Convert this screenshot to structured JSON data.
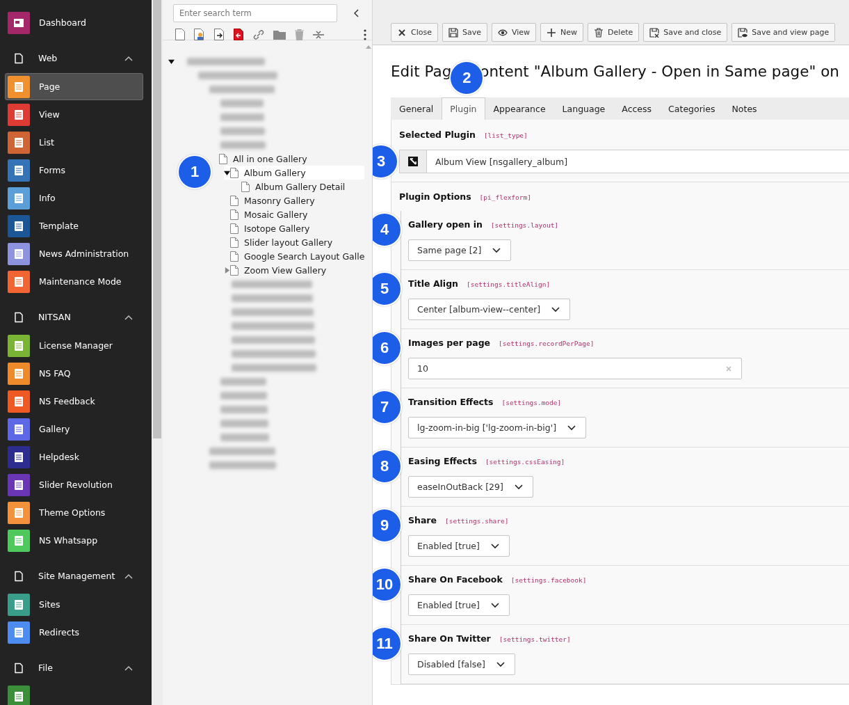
{
  "sidebar": {
    "sections": [
      {
        "kind": "link",
        "label": "Dashboard",
        "color": "#a4276a"
      },
      {
        "kind": "group",
        "label": "Web",
        "expanded": true,
        "items": [
          {
            "label": "Page",
            "color": "#f0902e",
            "selected": true
          },
          {
            "label": "View",
            "color": "#dd3b33",
            "selected": false
          },
          {
            "label": "List",
            "color": "#cf6434",
            "selected": false
          },
          {
            "label": "Forms",
            "color": "#3473b5",
            "selected": false
          },
          {
            "label": "Info",
            "color": "#5b9fd9",
            "selected": false
          },
          {
            "label": "Template",
            "color": "#1b5796",
            "selected": false
          },
          {
            "label": "News Administration",
            "color": "#8e93e0",
            "selected": false
          },
          {
            "label": "Maintenance Mode",
            "color": "#f16434",
            "selected": false
          }
        ]
      },
      {
        "kind": "group",
        "label": "NITSAN",
        "expanded": true,
        "items": [
          {
            "label": "License Manager",
            "color": "#7ab434",
            "selected": false
          },
          {
            "label": "NS FAQ",
            "color": "#ef8a2a",
            "selected": false
          },
          {
            "label": "NS Feedback",
            "color": "#ef5a24",
            "selected": false
          },
          {
            "label": "Gallery",
            "color": "#5d68e6",
            "selected": false
          },
          {
            "label": "Helpdesk",
            "color": "#2d2c8f",
            "selected": false
          },
          {
            "label": "Slider Revolution",
            "color": "#6a36b5",
            "selected": false
          },
          {
            "label": "Theme Options",
            "color": "#f4913b",
            "selected": false
          },
          {
            "label": "NS Whatsapp",
            "color": "#4fc95c",
            "selected": false
          }
        ]
      },
      {
        "kind": "group",
        "label": "Site Management",
        "expanded": true,
        "items": [
          {
            "label": "Sites",
            "color": "#3a9d8a",
            "selected": false
          },
          {
            "label": "Redirects",
            "color": "#4d8cf0",
            "selected": false
          }
        ]
      },
      {
        "kind": "group",
        "label": "File",
        "expanded": true,
        "items": [
          {
            "color": "#3c8f3a",
            "selected": false
          }
        ]
      }
    ]
  },
  "page_tree": {
    "search": {
      "placeholder": "Enter search term"
    },
    "nodes": [
      {
        "kind": "blurred",
        "expanded": true,
        "children": [
          {
            "kind": "blurred",
            "children": [
              {
                "kind": "blurred",
                "children": [
                  {
                    "kind": "blurred"
                  },
                  {
                    "kind": "blurred"
                  },
                  {
                    "kind": "blurred"
                  },
                  {
                    "kind": "blurred",
                    "children": [
                      {
                        "kind": "page",
                        "label": "All in one Gallery",
                        "selected": false,
                        "children": [
                          {
                            "kind": "page",
                            "label": "Album Gallery",
                            "selected": true,
                            "expanded": true,
                            "badge": "1",
                            "children": [
                              {
                                "kind": "page",
                                "label": "Album Gallery Detail",
                                "selected": false
                              }
                            ]
                          },
                          {
                            "kind": "page",
                            "label": "Masonry Gallery",
                            "selected": false
                          },
                          {
                            "kind": "page",
                            "label": "Mosaic Gallery",
                            "selected": false
                          },
                          {
                            "kind": "page",
                            "label": "Isotope Gallery",
                            "selected": false
                          },
                          {
                            "kind": "page",
                            "label": "Slider layout Gallery",
                            "selected": false
                          },
                          {
                            "kind": "page",
                            "label": "Google Search Layout Galle",
                            "selected": false
                          },
                          {
                            "kind": "page",
                            "label": "Zoom View Gallery",
                            "selected": false,
                            "expanded": false
                          }
                        ]
                      },
                      {
                        "kind": "blurred"
                      },
                      {
                        "kind": "blurred"
                      },
                      {
                        "kind": "blurred"
                      },
                      {
                        "kind": "blurred"
                      },
                      {
                        "kind": "blurred"
                      },
                      {
                        "kind": "blurred"
                      },
                      {
                        "kind": "blurred"
                      }
                    ]
                  },
                  {
                    "kind": "blurred"
                  },
                  {
                    "kind": "blurred"
                  },
                  {
                    "kind": "blurred"
                  },
                  {
                    "kind": "blurred"
                  },
                  {
                    "kind": "blurred"
                  }
                ]
              },
              {
                "kind": "blurred"
              },
              {
                "kind": "blurred"
              }
            ]
          }
        ]
      }
    ]
  },
  "toolbar": [
    "Close",
    "Save",
    "View",
    "New",
    "Delete",
    "Save and close",
    "Save and view page"
  ],
  "title": [
    "Edit Pag",
    "ontent \"Album Gallery - Open in Same page\" on"
  ],
  "title_badge": "2",
  "tabs": [
    {
      "label": "General",
      "selected": false
    },
    {
      "label": "Plugin",
      "selected": true
    },
    {
      "label": "Appearance",
      "selected": false
    },
    {
      "label": "Language",
      "selected": false
    },
    {
      "label": "Access",
      "selected": false
    },
    {
      "label": "Categories",
      "selected": false
    },
    {
      "label": "Notes",
      "selected": false
    }
  ],
  "selected_plugin": {
    "label": "Selected Plugin",
    "key": "[list_type]",
    "value": "Album View [nsgallery_album]",
    "badge": "3"
  },
  "plugin_options": {
    "label": "Plugin Options",
    "key": "[pi_flexform]",
    "fields": [
      {
        "kind": "select",
        "label": "Gallery open in",
        "key": "[settings.layout]",
        "value": "Same page [2]",
        "badge": "4"
      },
      {
        "kind": "select",
        "label": "Title Align",
        "key": "[settings.titleAlign]",
        "value": "Center [album-view--center]",
        "badge": "5"
      },
      {
        "kind": "input",
        "label": "Images per page",
        "key": "[settings.recordPerPage]",
        "value": "10",
        "badge": "6"
      },
      {
        "kind": "select",
        "label": "Transition Effects",
        "key": "[settings.mode]",
        "value": "lg-zoom-in-big ['lg-zoom-in-big']",
        "badge": "7"
      },
      {
        "kind": "select",
        "label": "Easing Effects",
        "key": "[settings.cssEasing]",
        "value": "easeInOutBack [29]",
        "badge": "8"
      },
      {
        "kind": "select",
        "label": "Share",
        "key": "[settings.share]",
        "value": "Enabled [true]",
        "badge": "9"
      },
      {
        "kind": "select",
        "label": "Share On Facebook",
        "key": "[settings.facebook]",
        "value": "Enabled [true]",
        "badge": "10"
      },
      {
        "kind": "select",
        "label": "Share On Twitter",
        "key": "[settings.twitter]",
        "value": "Disabled [false]",
        "badge": "11"
      }
    ]
  }
}
